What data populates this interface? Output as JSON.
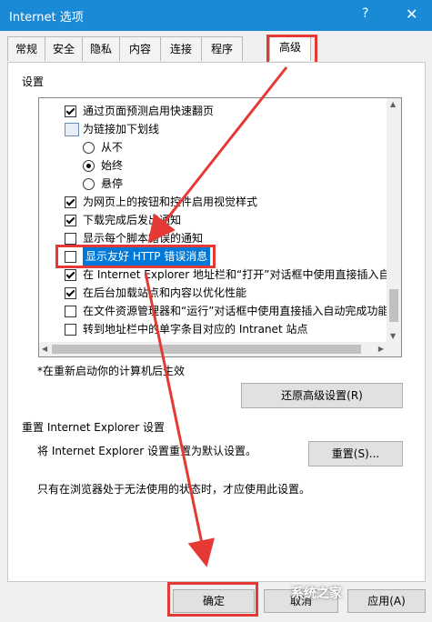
{
  "window": {
    "title": "Internet 选项",
    "help": "?",
    "close": "✕"
  },
  "tabs": [
    "常规",
    "安全",
    "隐私",
    "内容",
    "连接",
    "程序",
    "高级"
  ],
  "active_tab": "高级",
  "settings": {
    "group_label": "设置",
    "items": [
      {
        "type": "checkbox",
        "checked": true,
        "indent": 1,
        "label": "通过页面预测启用快速翻页"
      },
      {
        "type": "folder",
        "indent": 1,
        "label": "为链接加下划线"
      },
      {
        "type": "radio",
        "checked": false,
        "indent": 2,
        "label": "从不"
      },
      {
        "type": "radio",
        "checked": true,
        "indent": 2,
        "label": "始终"
      },
      {
        "type": "radio",
        "checked": false,
        "indent": 2,
        "label": "悬停"
      },
      {
        "type": "checkbox",
        "checked": true,
        "indent": 1,
        "label": "为网页上的按钮和控件启用视觉样式"
      },
      {
        "type": "checkbox",
        "checked": true,
        "indent": 1,
        "label": "下载完成后发出通知"
      },
      {
        "type": "checkbox",
        "checked": false,
        "indent": 1,
        "label": "显示每个脚本错误的通知"
      },
      {
        "type": "checkbox",
        "checked": false,
        "indent": 1,
        "label": "显示友好 HTTP 错误消息",
        "selected": true
      },
      {
        "type": "checkbox",
        "checked": true,
        "indent": 1,
        "label": "在 Internet Explorer 地址栏和“打开”对话框中使用直接插入自"
      },
      {
        "type": "checkbox",
        "checked": true,
        "indent": 1,
        "label": "在后台加载站点和内容以优化性能"
      },
      {
        "type": "checkbox",
        "checked": false,
        "indent": 1,
        "label": "在文件资源管理器和“运行”对话框中使用直接插入自动完成功能"
      },
      {
        "type": "checkbox",
        "checked": false,
        "indent": 1,
        "label": "转到地址栏中的单字条目对应的 Intranet 站点"
      }
    ],
    "restart_note": "*在重新启动你的计算机后生效",
    "restore_button": "还原高级设置(R)"
  },
  "reset": {
    "title": "重置 Internet Explorer 设置",
    "description": "将 Internet Explorer 设置重置为默认设置。",
    "button": "重置(S)...",
    "note": "只有在浏览器处于无法使用的状态时，才应使用此设置。"
  },
  "footer": {
    "ok": "确定",
    "cancel": "取消",
    "apply": "应用(A)"
  },
  "watermark": "系统之家",
  "colors": {
    "titlebar": "#1a8ad6",
    "highlight": "#e53935",
    "selection": "#0078d7"
  }
}
